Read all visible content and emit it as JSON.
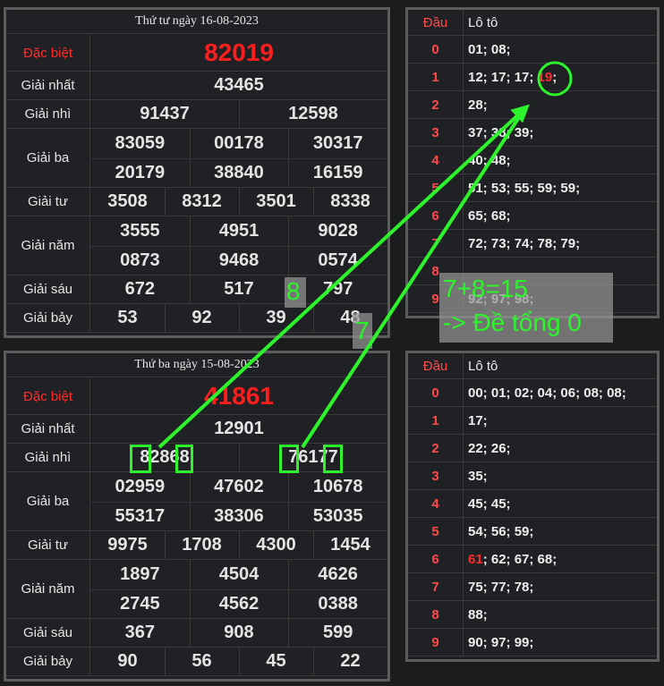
{
  "top": {
    "title": "Thứ tư ngày 16-08-2023",
    "rows": [
      {
        "label": "Đặc biệt",
        "red": true,
        "lines": [
          [
            "82019"
          ]
        ]
      },
      {
        "label": "Giải nhất",
        "lines": [
          [
            "43465"
          ]
        ]
      },
      {
        "label": "Giải nhì",
        "lines": [
          [
            "91437",
            "12598"
          ]
        ]
      },
      {
        "label": "Giải ba",
        "lines": [
          [
            "83059",
            "00178",
            "30317"
          ],
          [
            "20179",
            "38840",
            "16159"
          ]
        ]
      },
      {
        "label": "Giải tư",
        "lines": [
          [
            "3508",
            "8312",
            "3501",
            "8338"
          ]
        ]
      },
      {
        "label": "Giải năm",
        "lines": [
          [
            "3555",
            "4951",
            "9028"
          ],
          [
            "0873",
            "9468",
            "0574"
          ]
        ]
      },
      {
        "label": "Giải sáu",
        "lines": [
          [
            "672",
            "517",
            "797"
          ]
        ]
      },
      {
        "label": "Giải bảy",
        "lines": [
          [
            "53",
            "92",
            "39",
            "48"
          ]
        ]
      }
    ]
  },
  "bottom": {
    "title": "Thứ ba ngày 15-08-2023",
    "rows": [
      {
        "label": "Đặc biệt",
        "red": true,
        "lines": [
          [
            "41861"
          ]
        ]
      },
      {
        "label": "Giải nhất",
        "lines": [
          [
            "12901"
          ]
        ]
      },
      {
        "label": "Giải nhì",
        "lines": [
          [
            "82868",
            "76177"
          ]
        ]
      },
      {
        "label": "Giải ba",
        "lines": [
          [
            "02959",
            "47602",
            "10678"
          ],
          [
            "55317",
            "38306",
            "53035"
          ]
        ]
      },
      {
        "label": "Giải tư",
        "lines": [
          [
            "9975",
            "1708",
            "4300",
            "1454"
          ]
        ]
      },
      {
        "label": "Giải năm",
        "lines": [
          [
            "1897",
            "4504",
            "4626"
          ],
          [
            "2745",
            "4562",
            "0388"
          ]
        ]
      },
      {
        "label": "Giải sáu",
        "lines": [
          [
            "367",
            "908",
            "599"
          ]
        ]
      },
      {
        "label": "Giải bảy",
        "lines": [
          [
            "90",
            "56",
            "45",
            "22"
          ]
        ]
      }
    ]
  },
  "loto_top": {
    "head_dau": "Đầu",
    "head_loto": "Lô tô",
    "rows": [
      {
        "d": "0",
        "parts": [
          {
            "t": "01; 08;"
          }
        ]
      },
      {
        "d": "1",
        "parts": [
          {
            "t": "12; 17; 17; "
          },
          {
            "t": "19",
            "red": true
          },
          {
            "t": ";"
          }
        ]
      },
      {
        "d": "2",
        "parts": [
          {
            "t": "28;"
          }
        ]
      },
      {
        "d": "3",
        "parts": [
          {
            "t": "37; 38; 39;"
          }
        ]
      },
      {
        "d": "4",
        "parts": [
          {
            "t": "40; 48;"
          }
        ]
      },
      {
        "d": "5",
        "parts": [
          {
            "t": "51; 53; 55; 59; 59;"
          }
        ]
      },
      {
        "d": "6",
        "parts": [
          {
            "t": "65; 68;"
          }
        ]
      },
      {
        "d": "7",
        "parts": [
          {
            "t": "72; 73; 74; 78; 79;"
          }
        ]
      },
      {
        "d": "8",
        "parts": [
          {
            "t": ""
          }
        ]
      },
      {
        "d": "9",
        "parts": [
          {
            "t": "92; 97; 98;"
          }
        ]
      }
    ]
  },
  "loto_bottom": {
    "head_dau": "Đầu",
    "head_loto": "Lô tô",
    "rows": [
      {
        "d": "0",
        "parts": [
          {
            "t": "00; 01; 02; 04; 06; 08; 08;"
          }
        ]
      },
      {
        "d": "1",
        "parts": [
          {
            "t": "17;"
          }
        ]
      },
      {
        "d": "2",
        "parts": [
          {
            "t": "22; 26;"
          }
        ]
      },
      {
        "d": "3",
        "parts": [
          {
            "t": "35;"
          }
        ]
      },
      {
        "d": "4",
        "parts": [
          {
            "t": "45; 45;"
          }
        ]
      },
      {
        "d": "5",
        "parts": [
          {
            "t": "54; 56; 59;"
          }
        ]
      },
      {
        "d": "6",
        "parts": [
          {
            "t": "61",
            "red": true
          },
          {
            "t": "; 62; 67; 68;"
          }
        ]
      },
      {
        "d": "7",
        "parts": [
          {
            "t": "75; 77; 78;"
          }
        ]
      },
      {
        "d": "8",
        "parts": [
          {
            "t": "88;"
          }
        ]
      },
      {
        "d": "9",
        "parts": [
          {
            "t": "90; 97; 99;"
          }
        ]
      }
    ]
  },
  "annotation": {
    "digit8": "8",
    "digit7": "7",
    "line1": "7+8=15",
    "line2": "-> Đề tổng 0",
    "color": "#2cf52c"
  }
}
